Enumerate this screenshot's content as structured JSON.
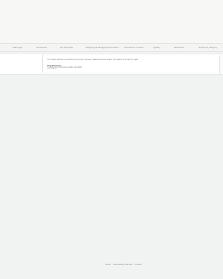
{
  "nav": {
    "items": [
      "Start Page",
      "Introduction",
      "Key Principles",
      "Designing & Managing Governance",
      "Structures & Content",
      "Quality",
      "Resources",
      "Browse by category"
    ]
  },
  "main": {
    "notice": "The search returned no results for your query. Showing related resources. Refine your search terms and try again.",
    "entry": {
      "title": "Key Resources",
      "description": "A curated list of documents, guides and toolkits",
      "meta": "Last updated"
    }
  },
  "footer": {
    "items": [
      "About",
      "Accessibility",
      "Sitemap",
      "Contact"
    ]
  }
}
